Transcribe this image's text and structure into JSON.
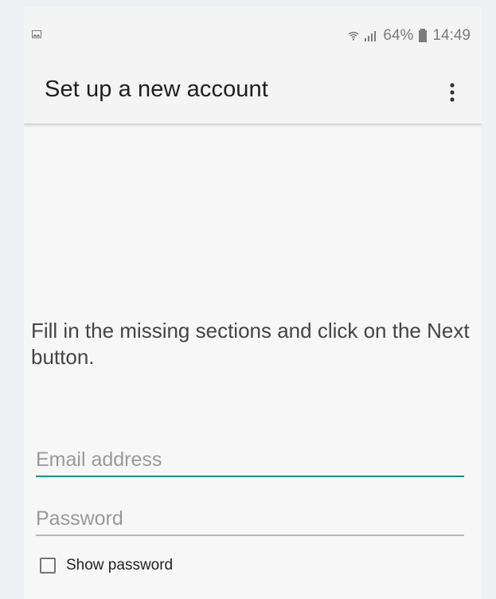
{
  "status_bar": {
    "battery_level": "64%",
    "time": "14:49",
    "left_icon": "image-icon",
    "wifi_icon": "wifi-icon",
    "signal_icon": "signal-icon",
    "battery_icon": "battery-icon"
  },
  "app_bar": {
    "title": "Set up a new account",
    "menu_icon": "more-vertical-icon"
  },
  "main": {
    "instruction": "Fill in the missing sections and click on the Next button.",
    "email": {
      "placeholder": "Email address",
      "value": ""
    },
    "password": {
      "placeholder": "Password",
      "value": ""
    },
    "show_password": {
      "label": "Show password",
      "checked": false
    }
  },
  "colors": {
    "accent": "#149489",
    "background": "#f7f7f7",
    "text": "#1f1f1f"
  }
}
